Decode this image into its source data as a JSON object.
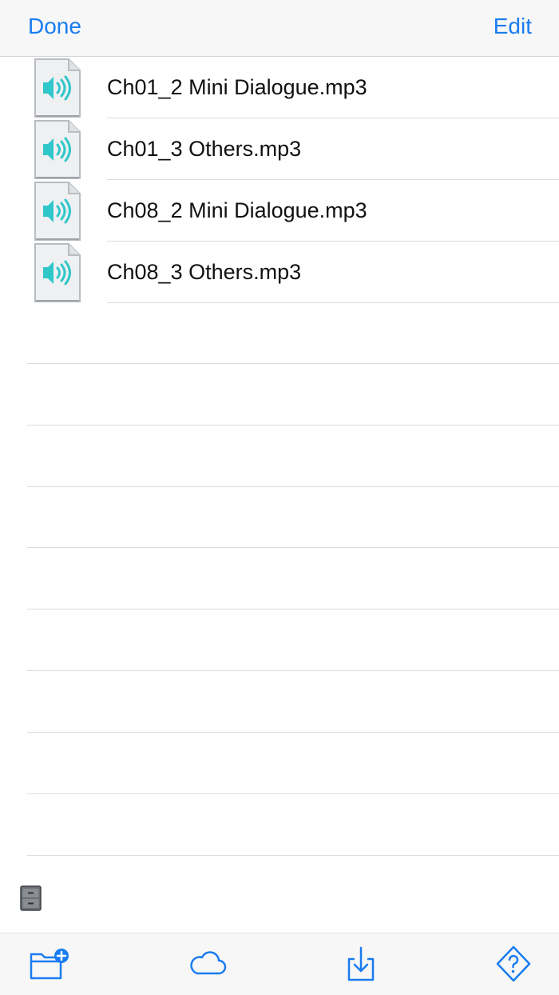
{
  "navbar": {
    "done_label": "Done",
    "edit_label": "Edit"
  },
  "files": [
    {
      "name": "Ch01_2 Mini Dialogue.mp3",
      "icon": "audio-file-icon"
    },
    {
      "name": "Ch01_3 Others.mp3",
      "icon": "audio-file-icon"
    },
    {
      "name": "Ch08_2 Mini Dialogue.mp3",
      "icon": "audio-file-icon"
    },
    {
      "name": "Ch08_3 Others.mp3",
      "icon": "audio-file-icon"
    }
  ],
  "toolbar": {
    "items": [
      "new-folder-icon",
      "cloud-icon",
      "import-download-icon",
      "help-question-icon"
    ]
  },
  "colors": {
    "accent": "#1a7cf0",
    "speaker": "#2fc7c9",
    "bar_bg": "#f7f7f7"
  }
}
